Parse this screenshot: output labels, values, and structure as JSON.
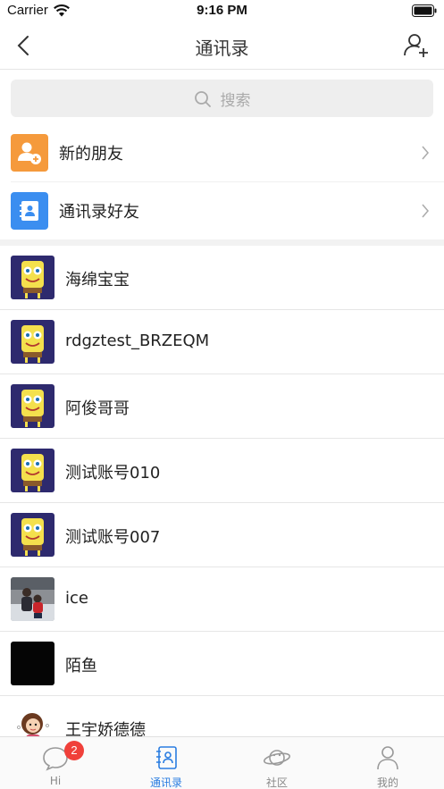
{
  "status_bar": {
    "carrier": "Carrier",
    "time": "9:16 PM"
  },
  "nav": {
    "title": "通讯录"
  },
  "search": {
    "placeholder": "搜索"
  },
  "special_rows": [
    {
      "label": "新的朋友",
      "icon": "new-friend-icon",
      "color": "#f59a3c"
    },
    {
      "label": "通讯录好友",
      "icon": "address-book-icon",
      "color": "#3b8ef0"
    }
  ],
  "contacts": [
    {
      "name": "海绵宝宝",
      "avatar": "spongebob"
    },
    {
      "name": "rdgztest_BRZEQM",
      "avatar": "spongebob"
    },
    {
      "name": "阿俊哥哥",
      "avatar": "spongebob"
    },
    {
      "name": "测试账号010",
      "avatar": "spongebob"
    },
    {
      "name": "测试账号007",
      "avatar": "spongebob"
    },
    {
      "name": "ice",
      "avatar": "photo"
    },
    {
      "name": "陌鱼",
      "avatar": "black"
    },
    {
      "name": "王宇娇德德",
      "avatar": "cartoon-girl"
    }
  ],
  "tabs": [
    {
      "label": "Hi",
      "icon": "chat-icon",
      "badge": "2",
      "active": false
    },
    {
      "label": "通讯录",
      "icon": "contacts-icon",
      "active": true
    },
    {
      "label": "社区",
      "icon": "planet-icon",
      "active": false
    },
    {
      "label": "我的",
      "icon": "profile-icon",
      "active": false
    }
  ],
  "colors": {
    "accent": "#2a7de1",
    "badge": "#f0403a"
  }
}
